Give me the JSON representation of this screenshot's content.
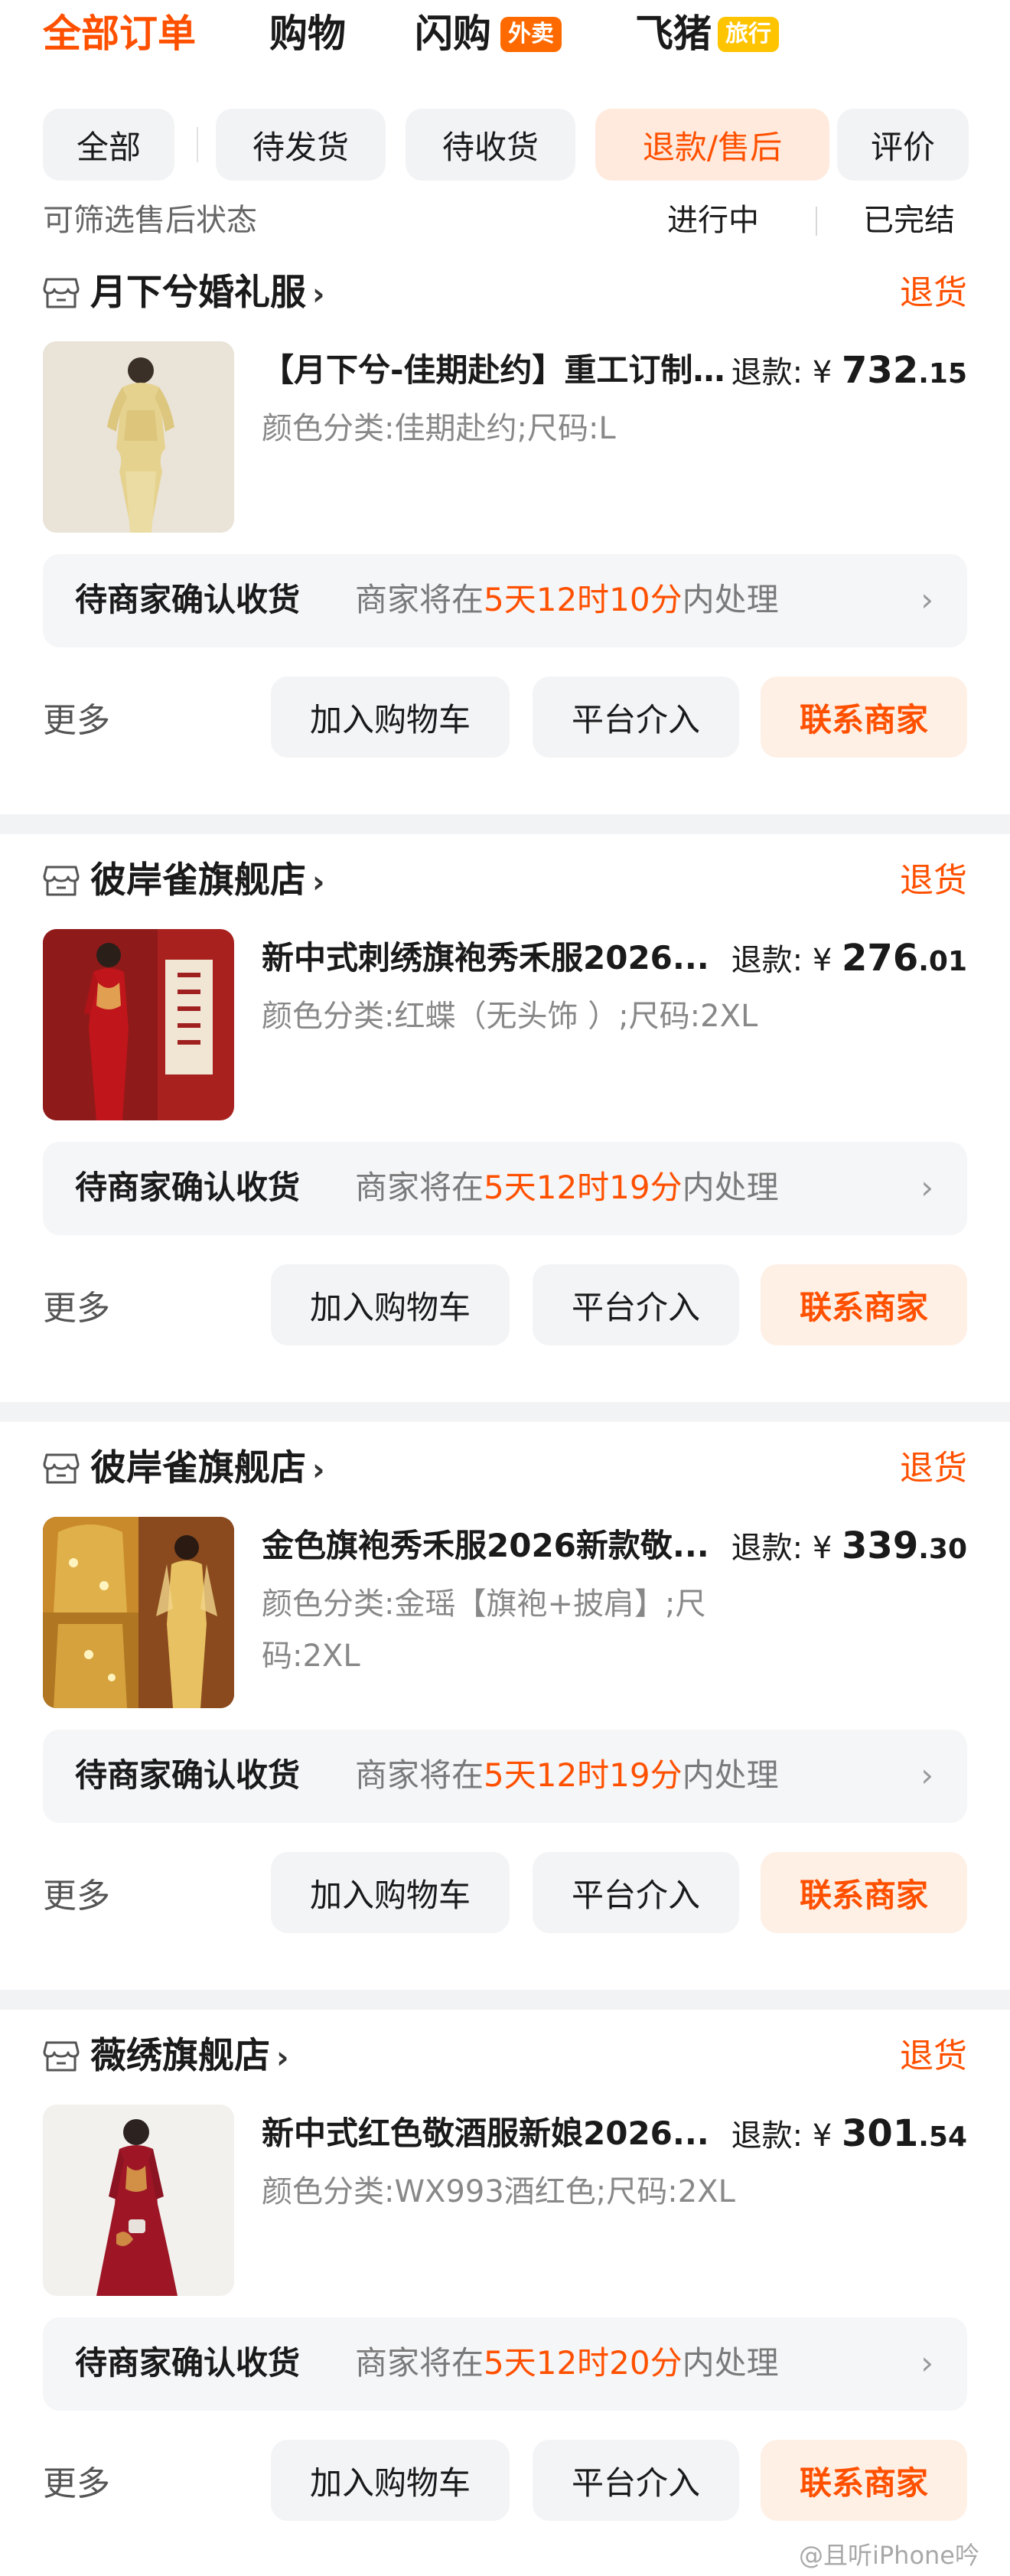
{
  "header": {
    "tabs": [
      {
        "label": "全部订单"
      },
      {
        "label": "购物"
      },
      {
        "label": "闪购",
        "badge": "外卖"
      },
      {
        "label": "飞猪",
        "badge": "旅行"
      }
    ]
  },
  "filters": [
    "全部",
    "待发货",
    "待收货",
    "退款/售后",
    "评价"
  ],
  "subheader": {
    "hint": "可筛选售后状态",
    "in_progress": "进行中",
    "completed": "已完结"
  },
  "orders": [
    {
      "shop": "月下兮婚礼服",
      "chevron": "›",
      "status": "退货",
      "title": "【月下兮-佳期赴约】重工订制...",
      "sku": "颜色分类:佳期赴约;尺码:L",
      "price_label": "退款:",
      "currency": "¥",
      "price_int": "732",
      "price_dec": ".15",
      "info_main": "待商家确认收货",
      "info_pre": "商家将在",
      "info_time": "5天12时10分",
      "info_post": "内处理",
      "info_chevron": "›",
      "more": "更多",
      "btn_cart": "加入购物车",
      "btn_platform": "平台介入",
      "btn_contact": "联系商家"
    },
    {
      "shop": "彼岸雀旗舰店",
      "chevron": "›",
      "status": "退货",
      "title": "新中式刺绣旗袍秀禾服2026...",
      "sku": "颜色分类:红蝶（无头饰 ）;尺码:2XL",
      "price_label": "退款:",
      "currency": "¥",
      "price_int": "276",
      "price_dec": ".01",
      "info_main": "待商家确认收货",
      "info_pre": "商家将在",
      "info_time": "5天12时19分",
      "info_post": "内处理",
      "info_chevron": "›",
      "more": "更多",
      "btn_cart": "加入购物车",
      "btn_platform": "平台介入",
      "btn_contact": "联系商家"
    },
    {
      "shop": "彼岸雀旗舰店",
      "chevron": "›",
      "status": "退货",
      "title": "金色旗袍秀禾服2026新款敬...",
      "sku": "颜色分类:金瑶【旗袍+披肩】;尺码:2XL",
      "price_label": "退款:",
      "currency": "¥",
      "price_int": "339",
      "price_dec": ".30",
      "info_main": "待商家确认收货",
      "info_pre": "商家将在",
      "info_time": "5天12时19分",
      "info_post": "内处理",
      "info_chevron": "›",
      "more": "更多",
      "btn_cart": "加入购物车",
      "btn_platform": "平台介入",
      "btn_contact": "联系商家"
    },
    {
      "shop": "薇绣旗舰店",
      "chevron": "›",
      "status": "退货",
      "title": "新中式红色敬酒服新娘2026...",
      "sku": "颜色分类:WX993酒红色;尺码:2XL",
      "price_label": "退款:",
      "currency": "¥",
      "price_int": "301",
      "price_dec": ".54",
      "info_main": "待商家确认收货",
      "info_pre": "商家将在",
      "info_time": "5天12时20分",
      "info_post": "内处理",
      "info_chevron": "›",
      "more": "更多",
      "btn_cart": "加入购物车",
      "btn_platform": "平台介入",
      "btn_contact": "联系商家"
    }
  ],
  "watermark": "@且听iPhone吟",
  "colors": {
    "accent": "#ff5000",
    "contact_bg": "#fff0e6",
    "page_bg": "#f2f3f5"
  },
  "icons": [
    "shop-icon",
    "chevron-right-icon"
  ]
}
